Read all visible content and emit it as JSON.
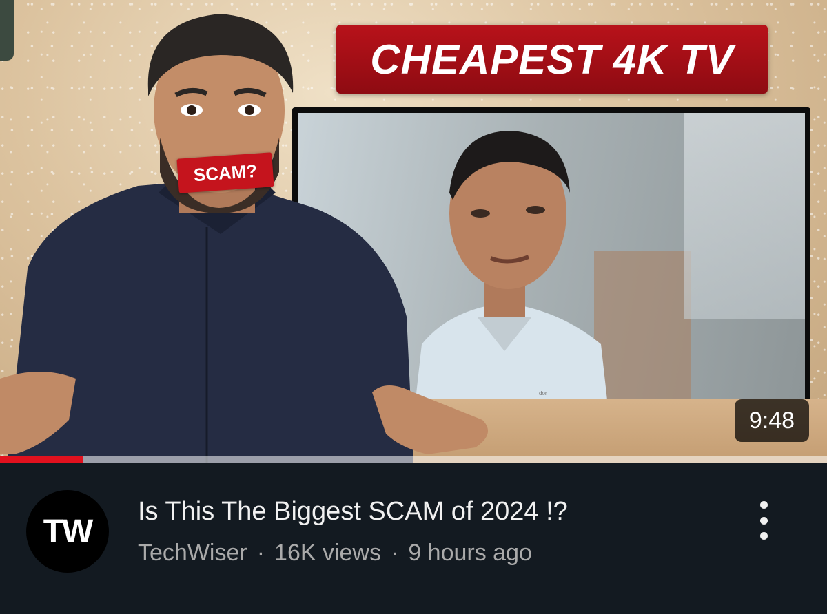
{
  "thumbnail": {
    "banner_text": "CHEAPEST 4K TV",
    "tape_text": "SCAM?",
    "duration": "9:48",
    "progress_watched": 0.1,
    "tv_brand": "dor"
  },
  "video": {
    "title": "Is This The Biggest SCAM of 2024 !?",
    "channel": "TechWiser",
    "views": "16K views",
    "age": "9 hours ago",
    "separator": "·"
  },
  "channel_avatar": {
    "initials": "TW"
  },
  "colors": {
    "background": "#131a21",
    "progress": "#e1111e",
    "banner": "#b8121a",
    "title_text": "#f1f1f1",
    "meta_text": "#aaaaaa"
  },
  "icons": {
    "menu": "more-vert-icon"
  }
}
